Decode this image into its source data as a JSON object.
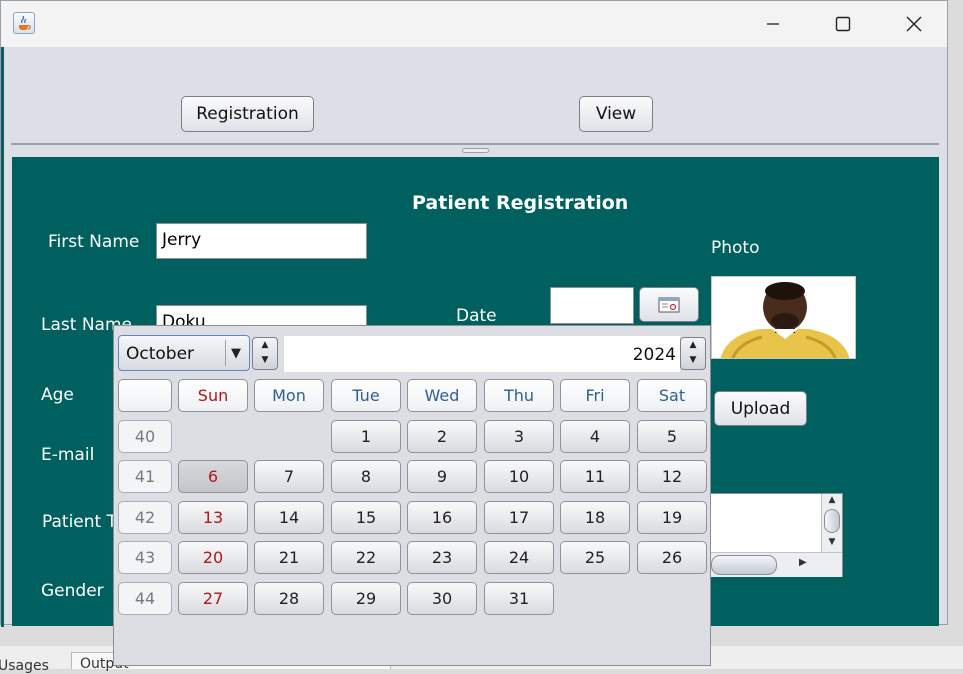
{
  "toolbar": {
    "registration_label": "Registration",
    "view_label": "View"
  },
  "form": {
    "title": "Patient Registration",
    "first_name_label": "First Name",
    "first_name_value": "Jerry",
    "last_name_label": "Last Name",
    "last_name_value": "Doku",
    "date_label": "Date",
    "date_value": "",
    "photo_label": "Photo",
    "age_label": "Age",
    "email_label": "E-mail",
    "patient_type_label": "Patient T",
    "gender_label": "Gender",
    "upload_label": "Upload"
  },
  "calendar": {
    "month": "October",
    "year": "2024",
    "weekdays": [
      "Sun",
      "Mon",
      "Tue",
      "Wed",
      "Thu",
      "Fri",
      "Sat"
    ],
    "weeks": [
      {
        "week": "40",
        "days": [
          "",
          "",
          "",
          "1",
          "2",
          "3",
          "4",
          "5"
        ]
      },
      {
        "week": "41",
        "days": [
          "6",
          "7",
          "8",
          "9",
          "10",
          "11",
          "12"
        ]
      },
      {
        "week": "42",
        "days": [
          "13",
          "14",
          "15",
          "16",
          "17",
          "18",
          "19"
        ]
      },
      {
        "week": "43",
        "days": [
          "20",
          "21",
          "22",
          "23",
          "24",
          "25",
          "26"
        ]
      },
      {
        "week": "44",
        "days": [
          "27",
          "28",
          "29",
          "30",
          "31"
        ]
      }
    ],
    "selected_day": "6",
    "colors": {
      "sunday": "#b01818",
      "weekday_header": "#2e5f93"
    }
  },
  "icons": {
    "app": "java-icon",
    "calendar_button": "calendar-icon"
  },
  "bottom_tabs": {
    "left": "Usages",
    "right": "Output"
  }
}
